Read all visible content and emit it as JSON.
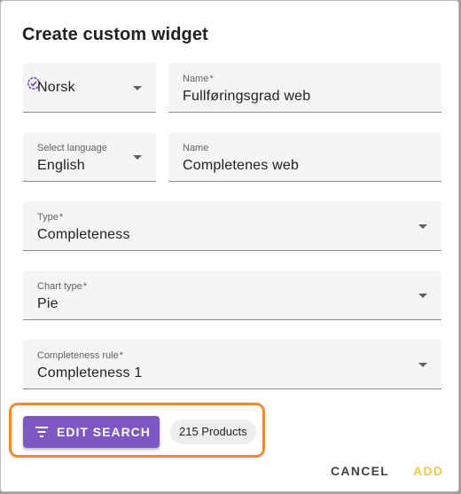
{
  "dialog": {
    "title": "Create custom widget"
  },
  "fields": {
    "locale": {
      "value": "Norsk"
    },
    "name_no": {
      "label": "Name",
      "required_mark": "*",
      "value": "Fullføringsgrad web"
    },
    "language": {
      "label": "Select language",
      "value": "English"
    },
    "name_en": {
      "label": "Name",
      "value": "Completenes web"
    },
    "type": {
      "label": "Type",
      "required_mark": "*",
      "value": "Completeness"
    },
    "chart_type": {
      "label": "Chart type",
      "required_mark": "*",
      "value": "Pie"
    },
    "completeness_rule": {
      "label": "Completeness rule",
      "required_mark": "*",
      "value": "Completeness 1"
    }
  },
  "search": {
    "edit_label": "EDIT SEARCH",
    "products_chip": "215 Products"
  },
  "actions": {
    "cancel": "CANCEL",
    "add": "ADD"
  },
  "colors": {
    "primary": "#7e57c2",
    "highlight": "#f08a32",
    "add_disabled": "#f5c842"
  },
  "icons": {
    "locale": "check-badge-icon",
    "dropdown": "arrow-drop-down-icon",
    "edit": "filter-list-icon"
  }
}
